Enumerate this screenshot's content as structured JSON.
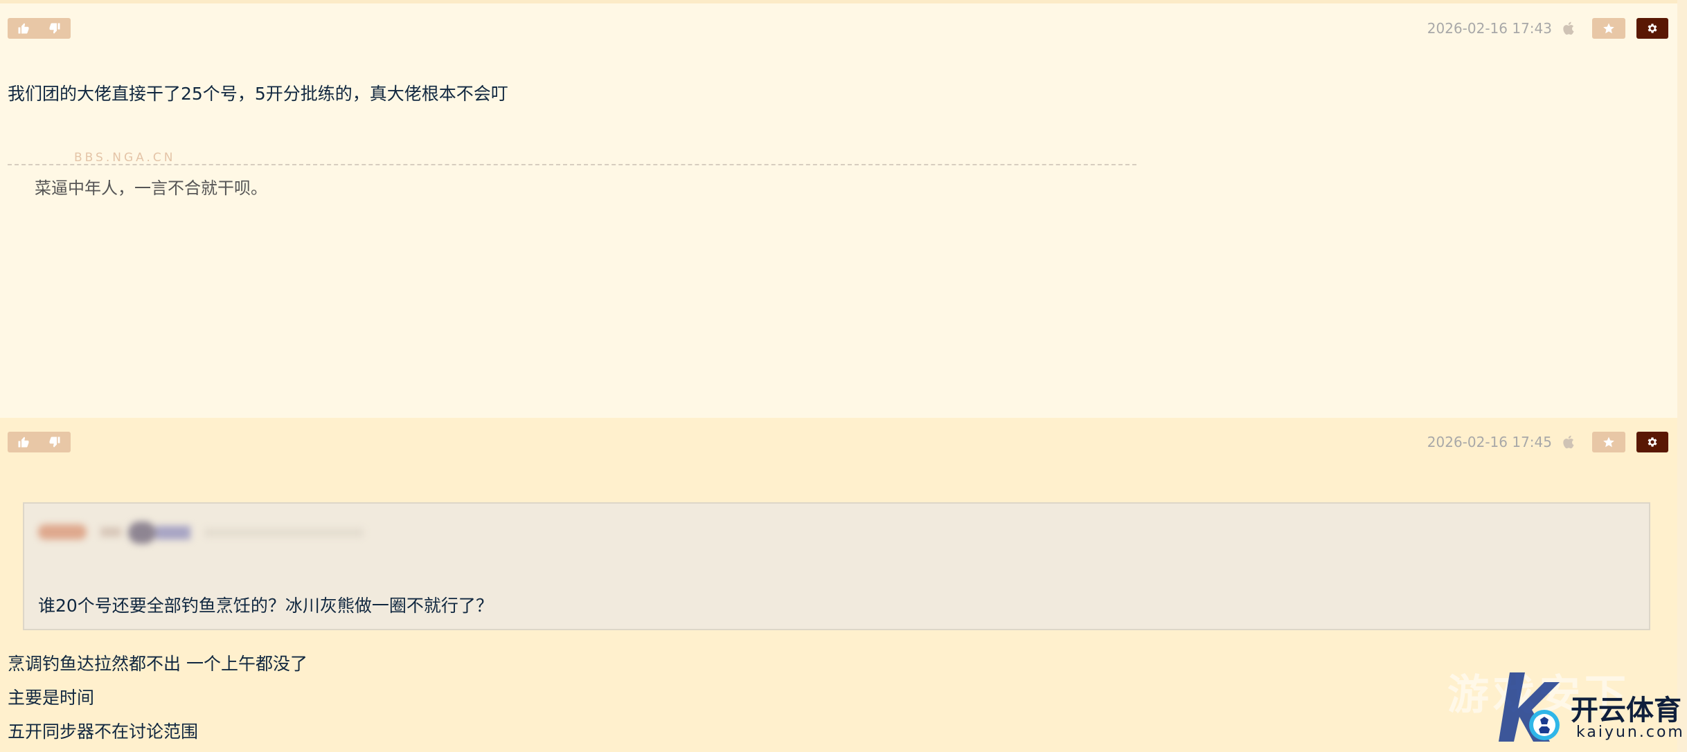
{
  "posts": [
    {
      "timestamp": "2026-02-16 17:43",
      "content": "我们团的大佬直接干了25个号，5开分批练的，真大佬根本不会叮",
      "signature_label": "BBS.NGA.CN",
      "signature": "菜逼中年人，一言不合就干呗。"
    },
    {
      "timestamp": "2026-02-16 17:45",
      "quote": "谁20个号还要全部钓鱼烹饪的？冰川灰熊做一圈不就行了？",
      "lines": [
        "烹调钓鱼达拉然都不出 一个上午都没了",
        "主要是时间",
        "五开同步器不在讨论范围"
      ]
    }
  ],
  "watermark": {
    "overlay_text": "游戏安下",
    "brand": "开云体育",
    "domain": "kaiyun.com"
  },
  "icons": {
    "upvote": "thumbs-up-icon",
    "downvote": "thumbs-down-icon",
    "device": "apple-icon",
    "favorite": "star-icon",
    "options": "gear-icon"
  },
  "colors": {
    "post_bg_1": "#fff8e5",
    "post_bg_2": "#fff0cd",
    "button_tan": "#e8c7a6",
    "button_dark": "#591804",
    "text": "#10273f"
  }
}
